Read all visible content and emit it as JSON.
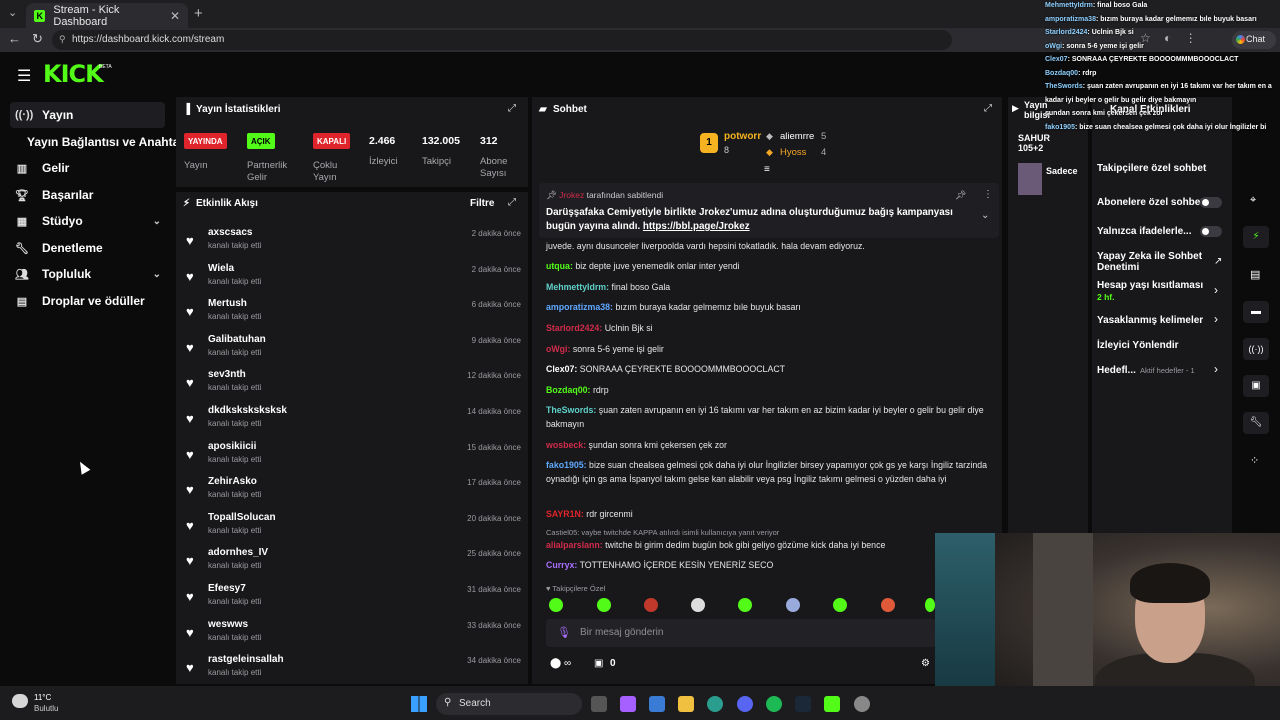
{
  "browser": {
    "tab_title": "Stream - Kick Dashboard",
    "url": "https://dashboard.kick.com/stream",
    "chat_button": "Chat"
  },
  "brand": {
    "logo": "KICK",
    "beta": "BETA",
    "accent": "#53fc18"
  },
  "sidebar": {
    "items": [
      {
        "label": "Yayın",
        "icon": "broadcast-icon"
      },
      {
        "label": "Gelir",
        "icon": "chart-icon"
      },
      {
        "label": "Başarılar",
        "icon": "trophy-icon"
      },
      {
        "label": "Stüdyo",
        "icon": "studio-icon"
      },
      {
        "label": "Denetleme",
        "icon": "wrench-icon"
      },
      {
        "label": "Topluluk",
        "icon": "people-icon"
      },
      {
        "label": "Droplar ve ödüller",
        "icon": "drops-icon"
      }
    ],
    "sub_item": "Yayın Bağlantısı ve Anahtarı"
  },
  "stats": {
    "title": "Yayın İstatistikleri",
    "items": [
      {
        "badge": "YAYINDA",
        "label": "Yayın",
        "color": "#e0242b"
      },
      {
        "badge": "AÇIK",
        "label": "Partnerlik Gelir",
        "color": "#53fc18"
      },
      {
        "badge": "KAPALI",
        "label": "Çoklu Yayın",
        "color": "#e0242b"
      }
    ],
    "numbers": [
      {
        "value": "2.466",
        "label": "İzleyici"
      },
      {
        "value": "132.005",
        "label": "Takipçi"
      },
      {
        "value": "312",
        "label": "Abone Sayısı"
      }
    ]
  },
  "feed": {
    "title": "Etkinlik Akışı",
    "filter": "Filtre",
    "rows": [
      {
        "name": "axscsacs",
        "sub": "kanalı takip etti",
        "time": "2 dakika önce"
      },
      {
        "name": "Wiela",
        "sub": "kanalı takip etti",
        "time": "2 dakika önce"
      },
      {
        "name": "Mertush",
        "sub": "kanalı takip etti",
        "time": "6 dakika önce"
      },
      {
        "name": "Galibatuhan",
        "sub": "kanalı takip etti",
        "time": "9 dakika önce"
      },
      {
        "name": "sev3nth",
        "sub": "kanalı takip etti",
        "time": "12 dakika önce"
      },
      {
        "name": "dkdksksksksksk",
        "sub": "kanalı takip etti",
        "time": "14 dakika önce"
      },
      {
        "name": "aposikiicii",
        "sub": "kanalı takip etti",
        "time": "15 dakika önce"
      },
      {
        "name": "ZehirAsko",
        "sub": "kanalı takip etti",
        "time": "17 dakika önce"
      },
      {
        "name": "TopallSolucan",
        "sub": "kanalı takip etti",
        "time": "20 dakika önce"
      },
      {
        "name": "adornhes_IV",
        "sub": "kanalı takip etti",
        "time": "25 dakika önce"
      },
      {
        "name": "Efeesy7",
        "sub": "kanalı takip etti",
        "time": "31 dakika önce"
      },
      {
        "name": "weswws",
        "sub": "kanalı takip etti",
        "time": "33 dakika önce"
      },
      {
        "name": "rastgeleinsallah",
        "sub": "kanalı takip etti",
        "time": "34 dakika önce"
      }
    ]
  },
  "chat": {
    "title": "Sohbet",
    "leaders": [
      {
        "rank": "1",
        "name": "potworr",
        "count": "8"
      },
      {
        "name": "aliemrre",
        "count": "5"
      },
      {
        "name": "Hyoss",
        "count": "4"
      }
    ],
    "pinned_by": "tarafından sabitlendi",
    "pinned_text": "Darüşşafaka Cemiyetiyle birlikte Jrokez'umuz adına oluşturduğumuz bağış kampanyası bugün yayına alındı.",
    "pinned_link": "https://bbl.page/Jrokez",
    "messages": [
      {
        "user": "",
        "text": "juvede. aynı dusunceler liverpoolda vardı hepsini tokatladık. hala devam ediyoruz.",
        "color": "#e6e6e6"
      },
      {
        "user": "utqua:",
        "text": "biz depte juve yenemedik onlar inter yendi",
        "color": "#53fc18"
      },
      {
        "user": "MehmettyIdrm:",
        "text": "final boso Gala",
        "color": "#5fd1c9"
      },
      {
        "user": "amporatizma38:",
        "text": "bızım buraya kadar gelmemız bıle buyuk basarı",
        "color": "#5fa8ff"
      },
      {
        "user": "Starlord2424:",
        "text": "Uclnin Bjk si",
        "color": "#d02b4a"
      },
      {
        "user": "oWgi:",
        "text": "sonra 5-6 yeme işi gelir",
        "color": "#d02b4a"
      },
      {
        "user": "Clex07:",
        "text": "SONRAAA ÇEYREKTE BOOOOMMMBOOOCLACT",
        "color": "#ffffff"
      },
      {
        "user": "Bozdaq00:",
        "text": "rdrp",
        "color": "#53fc18"
      },
      {
        "user": "TheSwords:",
        "text": "şuan zaten avrupanın en iyi 16 takımı var her takım en az bizim kadar iyi beyler o gelir bu gelir diye bakmayın",
        "color": "#5fd1c9"
      },
      {
        "user": "wosbeck:",
        "text": "şundan sonra kmi çekersen çek zor",
        "color": "#d02b4a"
      },
      {
        "user": "fako1905:",
        "text": "bize suan chealsea gelmesi çok daha iyi olur İngilizler birsey yapamıyor çok gs ye karşı İngiliz tarzinda oynadığı için gs ama İspanyol takım gelse kan alabilir veya psg İngiliz takımı gelmesi o yüzden daha iyi",
        "color": "#5fa8ff"
      },
      {
        "user": "SAYR1N:",
        "text": "rdr gircenmi",
        "color": "#e0242b"
      },
      {
        "user": "alialparslann:",
        "text": "twitche bi girim dedim bugün bok gibi geliyo gözüme kick daha iyi bence",
        "color": "#d02b4a"
      },
      {
        "user": "Curryx:",
        "text": "TOTTENHAMO İÇERDE KESİN YENERİZ SECO",
        "color": "#a870ff"
      }
    ],
    "reply_note": "Castiel05: vaybe twitchde KAPPA atılırdı isimli kullanıcıya yanıt veriyor",
    "emote_label": "Takipçilere Özel",
    "input_placeholder": "Bir mesaj gönderin",
    "footer_count": "0"
  },
  "controls": {
    "events_title": "Kanal Etkinlikleri",
    "stream_info": "Yayın bilgisi",
    "items": [
      {
        "label": "Takipçilere özel sohbet",
        "type": "text"
      },
      {
        "label": "Abonelere özel sohbet",
        "type": "toggle"
      },
      {
        "label": "Yalnızca ifadelerle...",
        "type": "toggle"
      },
      {
        "label": "Yapay Zeka ile Sohbet Denetimi",
        "type": "link"
      },
      {
        "label": "Hesap yaşı kısıtlaması",
        "sub": "2 hf.",
        "type": "arrow"
      },
      {
        "label": "Yasaklanmış kelimeler",
        "type": "arrow"
      },
      {
        "label": "İzleyici Yönlendir",
        "type": "text"
      },
      {
        "label": "Hedefl...",
        "sub": "Aktif hedefler - 1",
        "type": "arrow"
      }
    ]
  },
  "overlay": [
    {
      "user": "MehmettyIdrm",
      "text": ": final boso Gala"
    },
    {
      "user": "amporatizma38",
      "text": ": bızım buraya kadar gelmemız bıle buyuk basarı"
    },
    {
      "user": "Starlord2424",
      "text": ": Uclnin Bjk si"
    },
    {
      "user": "oWgi",
      "text": ": sonra 5-6 yeme işi gelir"
    },
    {
      "user": "Clex07",
      "text": ": SONRAAA ÇEYREKTE BOOOOMMMBOOOCLACT"
    },
    {
      "user": "Bozdaq00",
      "text": ": rdrp"
    },
    {
      "user": "TheSwords",
      "text": ": şuan zaten avrupanın en iyi 16 takımı var her takım en a"
    },
    {
      "user": "",
      "text": "kadar iyi beyler o gelir bu gelir diye bakmayın"
    },
    {
      "user": "",
      "text": "şundan sonra kmi çekersen çek zor"
    },
    {
      "user": "fako1905",
      "text": ": bize suan chealsea gelmesi çok daha iyi olur İngilizler bi"
    }
  ],
  "taskbar": {
    "temp": "11°C",
    "condition": "Bulutlu",
    "search": "Search"
  }
}
